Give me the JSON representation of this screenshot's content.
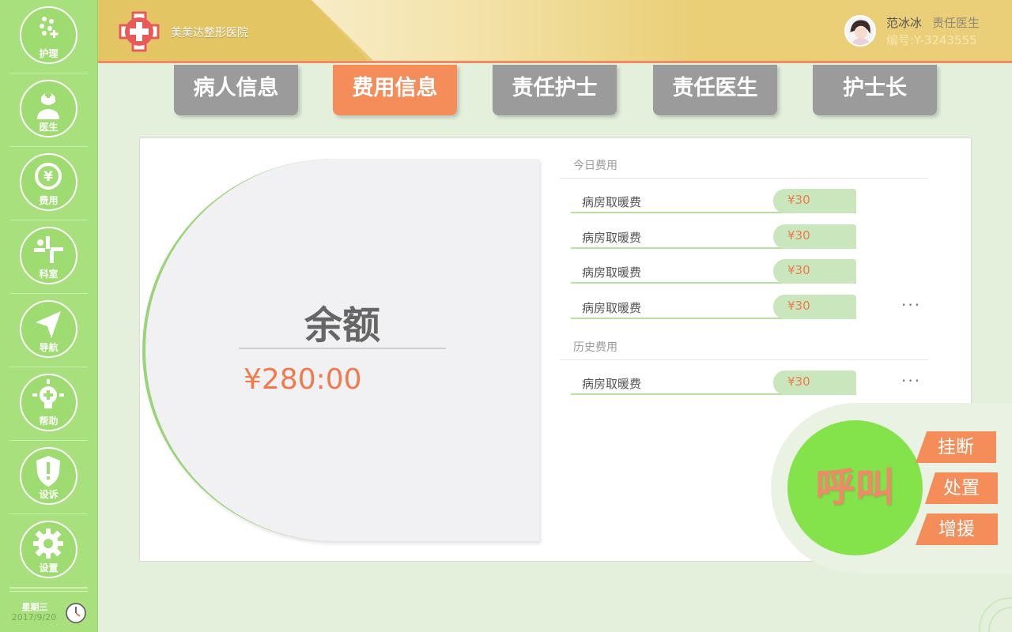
{
  "sidebar": {
    "items": [
      {
        "label": "护理",
        "icon": "nursing-icon"
      },
      {
        "label": "医生",
        "icon": "doctor-icon"
      },
      {
        "label": "费用",
        "icon": "yen-coin-icon"
      },
      {
        "label": "科室",
        "icon": "department-icon"
      },
      {
        "label": "导航",
        "icon": "navigation-arrow-icon"
      },
      {
        "label": "帮助",
        "icon": "help-bulb-icon"
      },
      {
        "label": "设诉",
        "icon": "complaint-shield-icon"
      },
      {
        "label": "设置",
        "icon": "gear-icon"
      }
    ],
    "weekday": "星期三",
    "date": "2017/9/20"
  },
  "header": {
    "hospital_name": "美美达整形医院",
    "user_name": "范冰冰",
    "user_role": "责任医生",
    "user_id": "编号:Y-3243555"
  },
  "tabs": [
    {
      "label": "病人信息",
      "active": false
    },
    {
      "label": "费用信息",
      "active": true
    },
    {
      "label": "责任护士",
      "active": false
    },
    {
      "label": "责任医生",
      "active": false
    },
    {
      "label": "护士长",
      "active": false
    }
  ],
  "balance": {
    "title": "余额",
    "value": "¥280:00"
  },
  "today_fees": {
    "title": "今日费用",
    "items": [
      {
        "name": "病房取暖费",
        "amount": "¥30"
      },
      {
        "name": "病房取暖费",
        "amount": "¥30"
      },
      {
        "name": "病房取暖费",
        "amount": "¥30"
      },
      {
        "name": "病房取暖费",
        "amount": "¥30"
      }
    ],
    "more": "···"
  },
  "history_fees": {
    "title": "历史费用",
    "items": [
      {
        "name": "病房取暖费",
        "amount": "¥30"
      }
    ],
    "more": "···"
  },
  "call": {
    "main_label": "呼叫",
    "hangup_label": "挂断",
    "handle_label": "处置",
    "reinforce_label": "增援"
  },
  "colors": {
    "sidebar": "#a9e07e",
    "accent": "#f48d5a",
    "call_green": "#84e24a",
    "tab_inactive": "#9b9b9b"
  }
}
